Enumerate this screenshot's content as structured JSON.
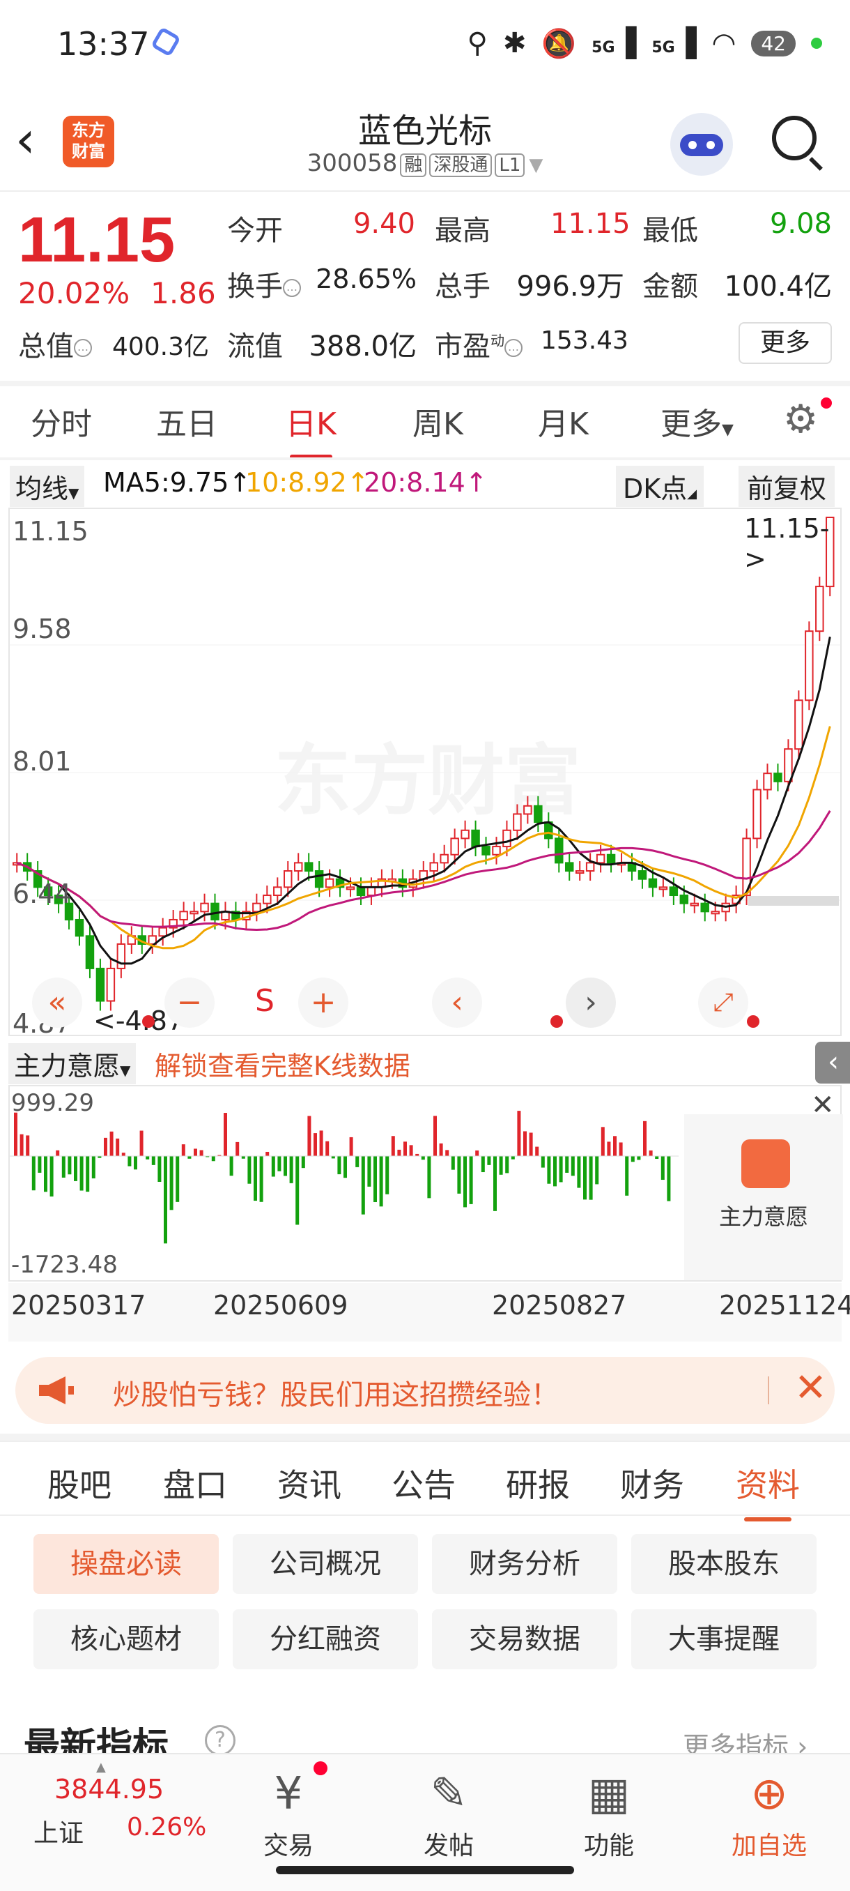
{
  "status_bar": {
    "time": "13:37",
    "battery": "42",
    "icons": [
      "location-icon",
      "bluetooth-icon",
      "mute-icon",
      "5g-signal-icon",
      "5g-signal-icon",
      "wifi-icon",
      "battery-icon"
    ]
  },
  "header": {
    "logo_text": "东方\n财富",
    "stock_name": "蓝色光标",
    "stock_code": "300058",
    "tags": [
      "融",
      "深股通",
      "L1"
    ]
  },
  "quote": {
    "price": "11.15",
    "change_pct": "20.02%",
    "change_amt": "1.86",
    "open_label": "今开",
    "open": "9.40",
    "high_label": "最高",
    "high": "11.15",
    "low_label": "最低",
    "low": "9.08",
    "turnover_label": "换手",
    "turnover": "28.65%",
    "volume_label": "总手",
    "volume": "996.9万",
    "amount_label": "金额",
    "amount": "100.4亿",
    "mktcap_label": "总值",
    "mktcap": "400.3亿",
    "float_label": "流值",
    "float": "388.0亿",
    "pe_label": "市盈",
    "pe_sup": "动",
    "pe": "153.43",
    "more_label": "更多"
  },
  "period_tabs": [
    "分时",
    "五日",
    "日K",
    "周K",
    "月K",
    "更多"
  ],
  "active_period": "日K",
  "ma_bar": {
    "selector": "均线",
    "ma5": "MA5:9.75↑",
    "ma10": "10:8.92↑",
    "ma20": "20:8.14↑",
    "dk": "DK点",
    "adjust": "前复权",
    "colors": {
      "ma5": "#111111",
      "ma10": "#f0a500",
      "ma20": "#c0187a"
    }
  },
  "kchart": {
    "y_labels": [
      "11.15",
      "9.58",
      "8.01",
      "6.44",
      "4.87"
    ],
    "max_annot": "11.15->",
    "min_annot": "<-4.87",
    "signal_s": "S",
    "watermark": "东方财富"
  },
  "flow_bar": {
    "selector": "主力意愿",
    "unlock_text": "解锁查看完整K线数据"
  },
  "flow_chart": {
    "top_label": "999.29",
    "bottom_label": "-1723.48",
    "tip_label": "主力意愿"
  },
  "dates": [
    "20250317",
    "20250609",
    "20250827",
    "20251124"
  ],
  "promo": {
    "text": "炒股怕亏钱？股民们用这招攒经验！"
  },
  "main_tabs": [
    "股吧",
    "盘口",
    "资讯",
    "公告",
    "研报",
    "财务",
    "资料"
  ],
  "active_main_tab": "资料",
  "chips": [
    "操盘必读",
    "公司概况",
    "财务分析",
    "股本股东",
    "核心题材",
    "分红融资",
    "交易数据",
    "大事提醒"
  ],
  "section": {
    "title": "最新指标",
    "more": "更多指标 ›"
  },
  "bottom_nav": {
    "index_value": "3844.95",
    "index_name": "上证",
    "index_pct": "0.26%",
    "items": [
      "交易",
      "发帖",
      "功能",
      "加自选"
    ]
  },
  "chart_data": {
    "type": "candlestick",
    "ylim": [
      4.87,
      11.15
    ],
    "y_ticks": [
      "11.15",
      "9.58",
      "8.01",
      "6.44",
      "4.87"
    ],
    "x_ticks": [
      "20250317",
      "20250609",
      "20250827",
      "20251124"
    ],
    "close_series": [
      6.9,
      6.8,
      6.6,
      6.5,
      6.4,
      6.2,
      6.0,
      5.6,
      5.2,
      5.6,
      5.9,
      6.0,
      5.9,
      6.0,
      6.1,
      6.2,
      6.3,
      6.3,
      6.4,
      6.2,
      6.3,
      6.2,
      6.3,
      6.4,
      6.5,
      6.6,
      6.8,
      6.9,
      6.8,
      6.6,
      6.7,
      6.6,
      6.6,
      6.5,
      6.6,
      6.7,
      6.7,
      6.6,
      6.7,
      6.8,
      6.9,
      7.0,
      7.2,
      7.3,
      7.1,
      7.0,
      7.1,
      7.3,
      7.5,
      7.6,
      7.4,
      7.2,
      6.9,
      6.8,
      6.8,
      6.9,
      7.0,
      6.9,
      6.9,
      6.8,
      6.7,
      6.6,
      6.6,
      6.5,
      6.4,
      6.4,
      6.3,
      6.3,
      6.4,
      6.5,
      7.2,
      7.8,
      8.0,
      7.9,
      8.3,
      8.9,
      9.75,
      10.3,
      11.15
    ],
    "ma": {
      "MA5": 9.75,
      "MA10": 8.92,
      "MA20": 8.14
    },
    "flow_range": [
      -1723.48,
      999.29
    ]
  }
}
